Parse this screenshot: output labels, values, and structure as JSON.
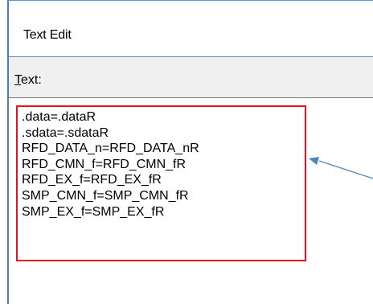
{
  "dialog": {
    "title": "Text Edit",
    "field_label_mnemonic": "T",
    "field_label_rest": "ext:"
  },
  "text_field": {
    "lines": [
      ".data=.dataR",
      ".sdata=.sdataR",
      "RFD_DATA_n=RFD_DATA_nR",
      "RFD_CMN_f=RFD_CMN_fR",
      "RFD_EX_f=RFD_EX_fR",
      "SMP_CMN_f=SMP_CMN_fR",
      "SMP_EX_f=SMP_EX_fR"
    ]
  },
  "annotation": {
    "highlight_color": "#e5141e",
    "arrow_color": "#4a86c5"
  }
}
